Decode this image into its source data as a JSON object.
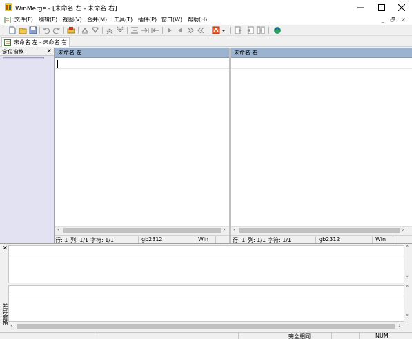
{
  "window": {
    "title": "WinMerge - [未命名 左 - 未命名 右]"
  },
  "menu": {
    "items": [
      "文件(F)",
      "编辑(E)",
      "视图(V)",
      "合并(M)",
      "工具(T)",
      "插件(P)",
      "窗口(W)",
      "帮助(H)"
    ],
    "mdi_controls": "_ 🗗 ×"
  },
  "tab": {
    "label": "未命名 左 - 未命名 右"
  },
  "location_pane": {
    "title": "定位窗格"
  },
  "left_pane": {
    "title": "未命名 左",
    "status": {
      "line": "行: 1",
      "col": "列: 1/1",
      "chars": "字符: 1/1",
      "encoding": "gb2312",
      "eol": "Win"
    }
  },
  "right_pane": {
    "title": "未命名 右",
    "status": {
      "line": "行: 1",
      "col": "列: 1/1",
      "chars": "字符: 1/1",
      "encoding": "gb2312",
      "eol": "Win"
    }
  },
  "diff_pane": {
    "label": "差异窗格"
  },
  "statusbar": {
    "result": "完全相同",
    "num": "NUM"
  },
  "colors": {
    "pane_header": "#9bb3ce",
    "location_bg": "#e2e2f2"
  }
}
